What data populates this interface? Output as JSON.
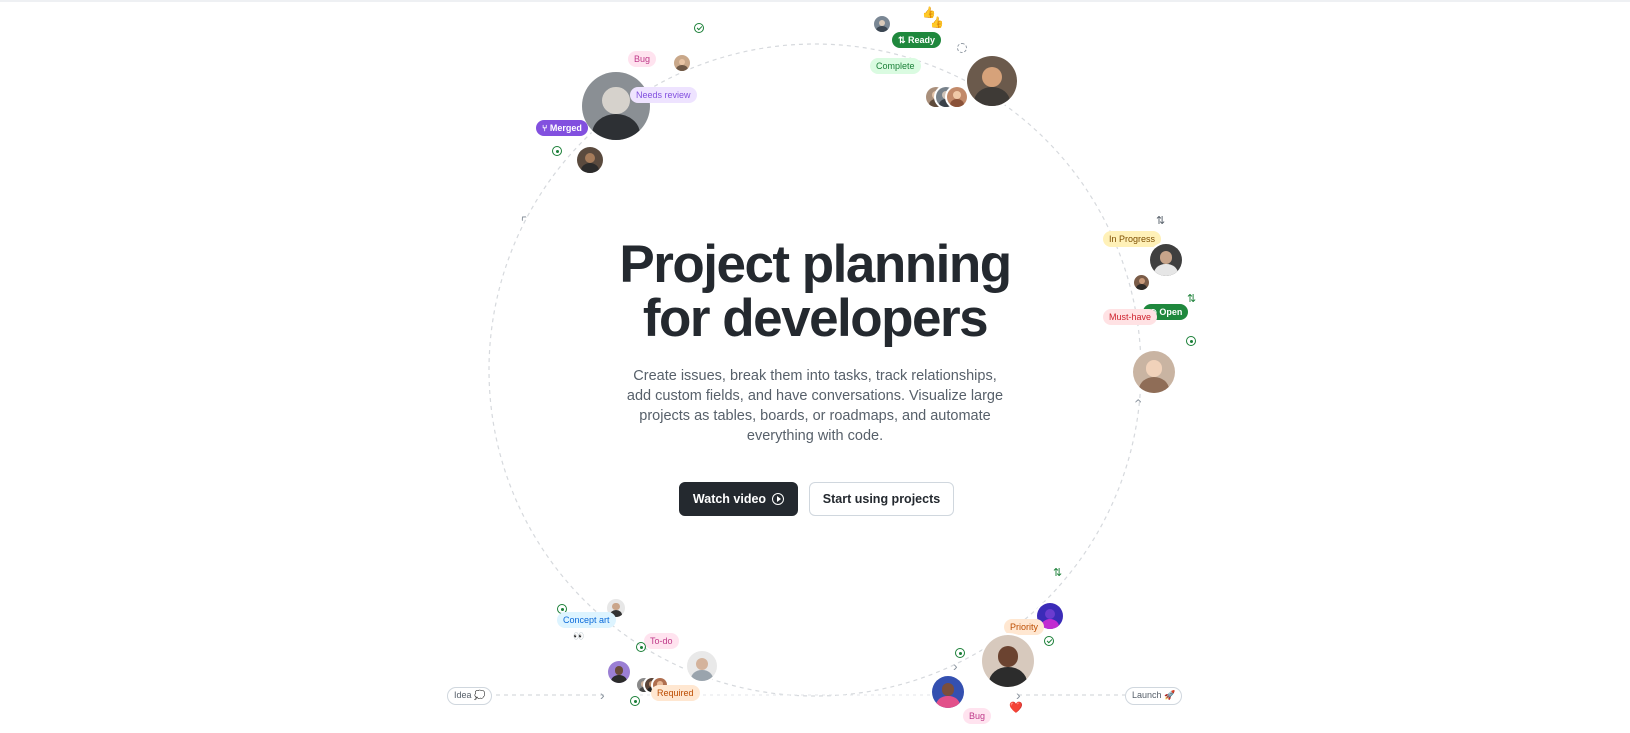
{
  "hero": {
    "title_line1": "Project planning",
    "title_line2": "for developers",
    "subtitle": "Create issues, break them into tasks, track relationships, add custom fields, and have conversations. Visualize large projects as tables, boards, or roadmaps, and automate everything with code.",
    "primary_button": "Watch video",
    "secondary_button": "Start using projects"
  },
  "labels": {
    "bug_top": "Bug",
    "needs_review": "Needs review",
    "merged": "Merged",
    "ready": "Ready",
    "complete": "Complete",
    "in_progress": "In Progress",
    "open": "Open",
    "must_have": "Must-have",
    "concept_art": "Concept art",
    "to_do": "To-do",
    "required": "Required",
    "priority": "Priority",
    "bug_bottom": "Bug",
    "idea": "Idea 💭",
    "launch": "Launch 🚀"
  },
  "colors": {
    "bug_bg": "#ffe3ef",
    "bug_fg": "#bf3989",
    "needs_review_bg": "#eee3ff",
    "needs_review_fg": "#8250df",
    "merged_bg": "#8250df",
    "ready_bg": "#1f883d",
    "complete_bg": "#dafbe1",
    "complete_fg": "#1a7f37",
    "in_progress_bg": "#fff1b8",
    "in_progress_fg": "#7d4e00",
    "open_bg": "#1f883d",
    "must_have_bg": "#ffe2e4",
    "must_have_fg": "#cf222e",
    "concept_art_bg": "#ddf4ff",
    "concept_art_fg": "#0969da",
    "to_do_bg": "#ffe3ef",
    "to_do_fg": "#bf3989",
    "required_bg": "#ffe7d1",
    "required_fg": "#bc4c00",
    "priority_bg": "#ffe7d1",
    "priority_fg": "#bc4c00"
  },
  "icons": {
    "play": "play-circle-icon",
    "merge": "git-merge-icon",
    "pull_request": "git-pull-request-icon",
    "issue_open": "issue-opened-icon",
    "issue_closed": "issue-closed-icon",
    "heart": "heart-emoji",
    "thumbs_up": "thumbs-up-emoji",
    "eyes": "eyes-emoji"
  }
}
